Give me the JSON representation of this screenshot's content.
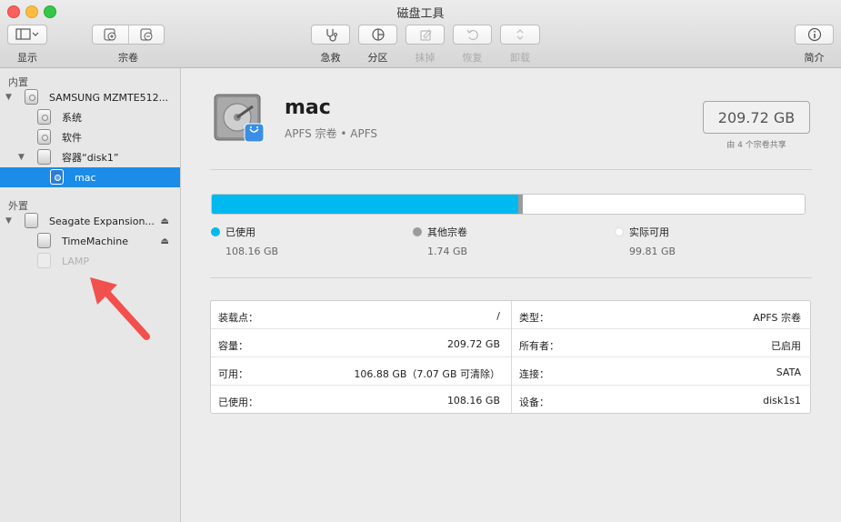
{
  "window": {
    "title": "磁盘工具"
  },
  "toolbar": {
    "view_label": "显示",
    "volume_label": "宗卷",
    "first_aid_label": "急救",
    "partition_label": "分区",
    "erase_label": "抹掉",
    "restore_label": "恢复",
    "unmount_label": "卸载",
    "info_label": "简介"
  },
  "sidebar": {
    "internal_header": "内置",
    "external_header": "外置",
    "items": [
      {
        "label": "SAMSUNG MZMTE512..."
      },
      {
        "label": "系统"
      },
      {
        "label": "软件"
      },
      {
        "label": "容器“disk1”"
      },
      {
        "label": "mac"
      },
      {
        "label": "Seagate Expansion..."
      },
      {
        "label": "TimeMachine"
      },
      {
        "label": "LAMP"
      }
    ]
  },
  "volume": {
    "name": "mac",
    "subtitle": "APFS 宗卷 • APFS",
    "capacity": "209.72 GB",
    "shared_note": "由 4 个宗卷共享"
  },
  "usage": {
    "used_fraction": 0.517,
    "other_fraction": 0.0083,
    "colors": {
      "used": "#00b9ee",
      "other": "#9b9b9b",
      "free": "#ffffff"
    },
    "legend": [
      {
        "label": "已使用",
        "value": "108.16 GB"
      },
      {
        "label": "其他宗卷",
        "value": "1.74 GB"
      },
      {
        "label": "实际可用",
        "value": "99.81 GB"
      }
    ]
  },
  "info": {
    "left": [
      {
        "key": "装载点：",
        "value": "/"
      },
      {
        "key": "容量：",
        "value": "209.72 GB"
      },
      {
        "key": "可用：",
        "value": "106.88 GB（7.07 GB 可清除）"
      },
      {
        "key": "已使用：",
        "value": "108.16 GB"
      }
    ],
    "right": [
      {
        "key": "类型：",
        "value": "APFS 宗卷"
      },
      {
        "key": "所有者：",
        "value": "已启用"
      },
      {
        "key": "连接：",
        "value": "SATA"
      },
      {
        "key": "设备：",
        "value": "disk1s1"
      }
    ]
  }
}
